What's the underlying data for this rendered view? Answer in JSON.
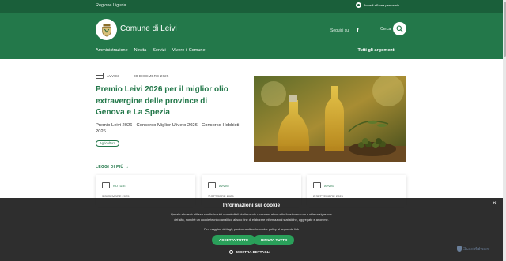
{
  "topbar": {
    "region": "Regione Liguria",
    "login": "Accedi all'area personale"
  },
  "header": {
    "site_name": "Comune di Leivi",
    "follow": "Seguici su",
    "facebook": "f",
    "search": "Cerca",
    "nav": [
      "Amministrazione",
      "Novità",
      "Servizi",
      "Vivere il Comune"
    ],
    "all_topics": "Tutti gli argomenti"
  },
  "featured": {
    "category": "AVVISI",
    "separator": "—",
    "date": "30 DICEMBRE 2025",
    "title": "Premio Leivi 2026 per il miglior olio extravergine delle province di Genova e La Spezia",
    "description": "Premio Leivi 2026 - Concorso Miglior Uliveto 2026 - Concorso Hobbisti 2026",
    "tag": "Agricoltura"
  },
  "read_more": "LEGGI DI PIÙ",
  "cards": [
    {
      "category": "NOTIZIE",
      "date": "3 DICEMBRE 2025"
    },
    {
      "category": "AVVISI",
      "date": "7 OTTOBRE 2025"
    },
    {
      "category": "AVVISI",
      "date": "2 SETTEMBRE 2025"
    }
  ],
  "cookie": {
    "title": "Informazioni sui cookie",
    "body": "Questo sito web utilizza cookie tecnici e assimilati strettamente necessari al corretto funzionamento e allla navigazione del sito, nonchè un cookie tecnico analitico al solo fine di elaborare informazioni statistiche, aggregate e anonime.",
    "body2": "Per maggiori dettagli, puoi consultare la cookie policy al seguente link",
    "accept": "ACCETTA TUTTO",
    "reject": "RIFIUTA TUTTO",
    "details": "MOSTRA DETTAGLI",
    "close": "×",
    "brand": "ScanMalware"
  },
  "colors": {
    "brand_dark": "#1a5f3a",
    "brand": "#23784a",
    "accept_button": "#2aa05a"
  }
}
